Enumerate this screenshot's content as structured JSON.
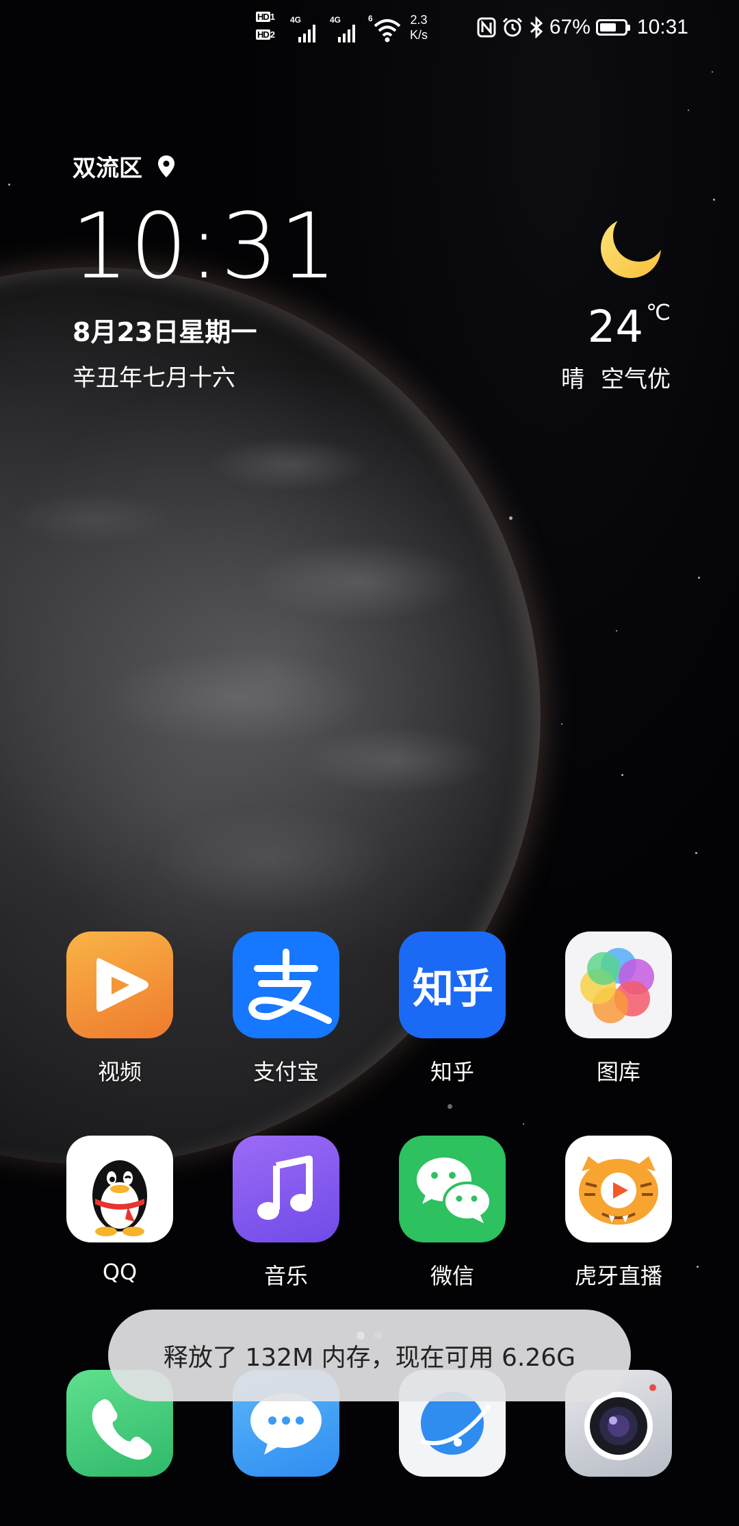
{
  "status_bar": {
    "hd1": "HD",
    "hd1_sub": "1",
    "hd2": "HD",
    "hd2_sub": "2",
    "sim1_tech": "4G",
    "sim2_tech": "4G",
    "wifi_tech": "6",
    "net_speed_value": "2.3",
    "net_speed_unit": "K/s",
    "battery_percent": "67%",
    "battery_level": 0.67,
    "time": "10:31",
    "icons": [
      "hd-icon",
      "signal-icon",
      "signal-icon",
      "wifi-icon",
      "nfc-icon",
      "alarm-icon",
      "bluetooth-icon",
      "battery-icon"
    ]
  },
  "clock_widget": {
    "location": "双流区",
    "location_icon": "location-pin-icon",
    "time": "10:31",
    "date": "8月23日星期一",
    "lunar_date": "辛丑年七月十六"
  },
  "weather_widget": {
    "icon": "crescent-moon-icon",
    "temperature": "24",
    "unit": "℃",
    "condition": "晴",
    "air_quality": "空气优"
  },
  "apps": [
    {
      "label": "视频",
      "icon": "video-play-icon",
      "color": "#F5973A"
    },
    {
      "label": "支付宝",
      "icon": "alipay-icon",
      "color": "#1677FF"
    },
    {
      "label": "知乎",
      "icon": "zhihu-icon",
      "color": "#1A6AF5",
      "glyph": "知乎"
    },
    {
      "label": "图库",
      "icon": "gallery-flower-icon",
      "color": "#F4F4F6"
    },
    {
      "label": "QQ",
      "icon": "qq-penguin-icon",
      "color": "#FFFFFF"
    },
    {
      "label": "音乐",
      "icon": "music-note-icon",
      "color": "#8B5CF0"
    },
    {
      "label": "微信",
      "icon": "wechat-icon",
      "color": "#2DC160"
    },
    {
      "label": "虎牙直播",
      "icon": "huya-tiger-icon",
      "color": "#FFFFFF"
    }
  ],
  "dock": [
    {
      "icon": "phone-icon",
      "color": "#3ED07A"
    },
    {
      "icon": "messages-icon",
      "color": "#3A9BF5"
    },
    {
      "icon": "browser-icon",
      "color": "#F2F4F7"
    },
    {
      "icon": "camera-icon",
      "color": "#C9CCD3"
    }
  ],
  "page_indicator": {
    "pages": 2,
    "current": 1
  },
  "toast": {
    "text": "释放了 132M 内存，现在可用 6.26G"
  }
}
